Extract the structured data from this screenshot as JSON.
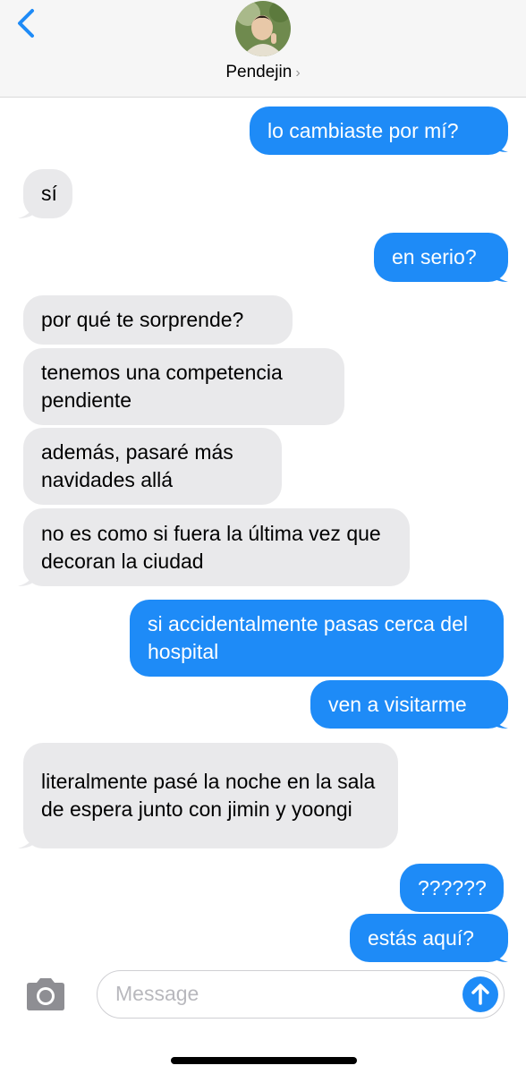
{
  "contact": {
    "name": "Pendejin",
    "chevron": "›"
  },
  "messages": [
    {
      "side": "sent",
      "text": "lo cambiaste por mí?"
    },
    {
      "side": "recv",
      "text": "sí"
    },
    {
      "side": "sent",
      "text": "en serio?"
    },
    {
      "side": "recv",
      "text": "por qué te sorprende?"
    },
    {
      "side": "recv",
      "text": "tenemos una competencia pendiente"
    },
    {
      "side": "recv",
      "text": "además, pasaré más navidades allá"
    },
    {
      "side": "recv",
      "text": "no es como si fuera la última vez que decoran la ciudad"
    },
    {
      "side": "sent",
      "text": "si accidentalmente pasas cerca del hospital"
    },
    {
      "side": "sent",
      "text": "ven a visitarme"
    },
    {
      "side": "recv",
      "text": "literalmente pasé la noche en la sala de espera junto con jimin y yoongi"
    },
    {
      "side": "sent",
      "text": "??????"
    },
    {
      "side": "sent",
      "text": "estás aquí?"
    }
  ],
  "composer": {
    "placeholder": "Message"
  },
  "icons": {
    "back": "chevron-left-icon",
    "camera": "camera-icon",
    "send": "arrow-up-icon"
  },
  "colors": {
    "sent_bubble": "#1e8bf7",
    "recv_bubble": "#e9e9eb",
    "accent": "#1e8bf7"
  }
}
